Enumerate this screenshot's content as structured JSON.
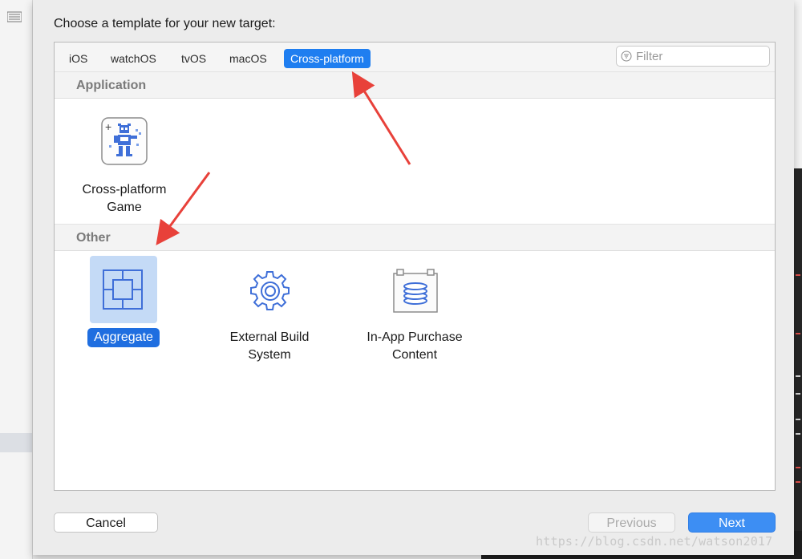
{
  "dialog": {
    "title": "Choose a template for your new target:"
  },
  "tabs": [
    {
      "label": "iOS",
      "active": false
    },
    {
      "label": "watchOS",
      "active": false
    },
    {
      "label": "tvOS",
      "active": false
    },
    {
      "label": "macOS",
      "active": false
    },
    {
      "label": "Cross-platform",
      "active": true
    }
  ],
  "filter": {
    "placeholder": "Filter",
    "value": "",
    "icon": "filter-icon"
  },
  "sections": [
    {
      "title": "Application",
      "templates": [
        {
          "label_line1": "Cross-platform",
          "label_line2": "Game",
          "icon": "game-robot-icon",
          "selected": false
        }
      ]
    },
    {
      "title": "Other",
      "templates": [
        {
          "label_line1": "Aggregate",
          "label_line2": "",
          "icon": "aggregate-icon",
          "selected": true
        },
        {
          "label_line1": "External Build",
          "label_line2": "System",
          "icon": "gear-icon",
          "selected": false
        },
        {
          "label_line1": "In-App Purchase",
          "label_line2": "Content",
          "icon": "in-app-purchase-icon",
          "selected": false
        }
      ]
    }
  ],
  "buttons": {
    "cancel": "Cancel",
    "previous": "Previous",
    "previous_enabled": false,
    "next": "Next"
  },
  "watermark": "https://blog.csdn.net/watson2017",
  "colors": {
    "accent": "#1f7ef0",
    "selection_bg": "#c4daf6",
    "annotation_arrow": "#e8413a"
  }
}
